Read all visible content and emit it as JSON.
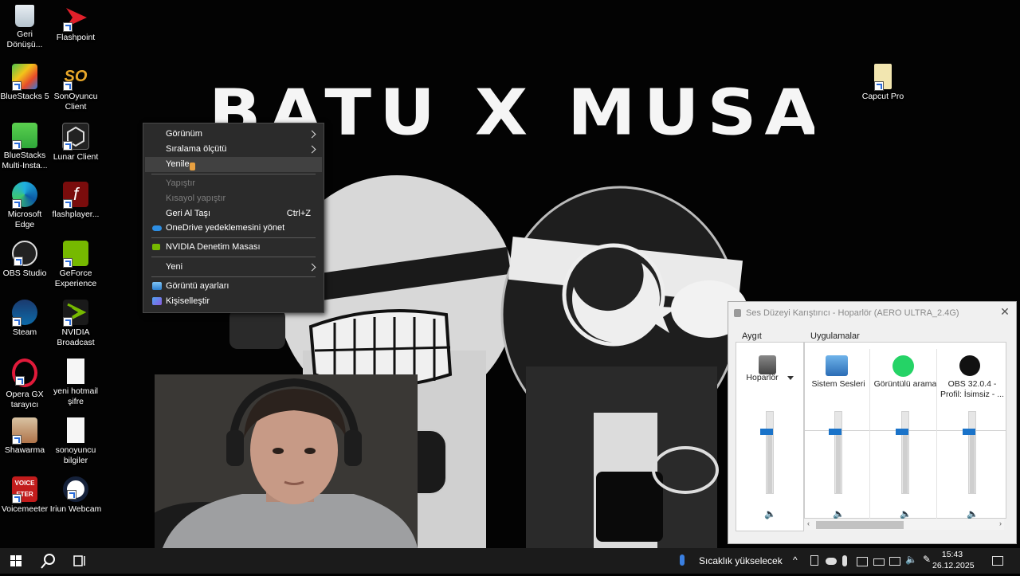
{
  "wallpaper": {
    "title": "BATU X MUSA"
  },
  "desktop_icons": [
    {
      "label": "Geri Dönüşü...",
      "icon": "recycle-bin-icon"
    },
    {
      "label": "Flashpoint",
      "icon": "flashpoint-icon"
    },
    {
      "label": "BlueStacks 5",
      "icon": "bluestacks-icon"
    },
    {
      "label": "SonOyuncu Client",
      "icon": "sonoyuncu-icon"
    },
    {
      "label": "BlueStacks Multi-Insta...",
      "icon": "bluestacks-multi-icon"
    },
    {
      "label": "Lunar Client",
      "icon": "lunar-client-icon"
    },
    {
      "label": "Microsoft Edge",
      "icon": "edge-icon"
    },
    {
      "label": "flashplayer...",
      "icon": "flashplayer-icon"
    },
    {
      "label": "OBS Studio",
      "icon": "obs-icon"
    },
    {
      "label": "GeForce Experience",
      "icon": "geforce-icon"
    },
    {
      "label": "Steam",
      "icon": "steam-icon"
    },
    {
      "label": "NVIDIA Broadcast",
      "icon": "nvidia-broadcast-icon"
    },
    {
      "label": "Opera GX tarayıcı",
      "icon": "opera-gx-icon"
    },
    {
      "label": "yeni hotmail şifre",
      "icon": "text-file-icon"
    },
    {
      "label": "Shawarma",
      "icon": "shawarma-icon"
    },
    {
      "label": "sonoyuncu bilgiler",
      "icon": "text-file-icon"
    },
    {
      "label": "Voicemeeter",
      "icon": "voicemeeter-icon"
    },
    {
      "label": "Iriun Webcam",
      "icon": "iriun-webcam-icon"
    },
    {
      "label": "Capcut Pro",
      "icon": "capcut-icon"
    }
  ],
  "context_menu": {
    "items": [
      {
        "label": "Görünüm",
        "submenu": true
      },
      {
        "label": "Sıralama ölçütü",
        "submenu": true
      },
      {
        "label": "Yenile",
        "hover": true
      },
      {
        "label": "Yapıştır",
        "disabled": true
      },
      {
        "label": "Kısayol yapıştır",
        "disabled": true
      },
      {
        "label": "Geri Al Taşı",
        "shortcut": "Ctrl+Z"
      },
      {
        "label": "OneDrive yedeklemesini yönet",
        "icon": "onedrive-icon"
      },
      {
        "label": "NVIDIA Denetim Masası",
        "icon": "nvidia-icon"
      },
      {
        "label": "Yeni",
        "submenu": true
      },
      {
        "label": "Görüntü ayarları",
        "icon": "display-icon"
      },
      {
        "label": "Kişiselleştir",
        "icon": "personalize-icon"
      }
    ]
  },
  "mixer": {
    "title": "Ses Düzeyi Karıştırıcı - Hoparlör (AERO ULTRA_2.4G)",
    "device_section": "Aygıt",
    "apps_section": "Uygulamalar",
    "channels": [
      {
        "name": "Hoparlör",
        "icon": "speaker-device-icon",
        "volume": 0.75,
        "dropdown": true
      },
      {
        "name": "Sistem Sesleri",
        "icon": "system-sounds-icon",
        "volume": 0.75
      },
      {
        "name": "Görüntülü arama",
        "icon": "whatsapp-icon",
        "volume": 0.75
      },
      {
        "name": "OBS 32.0.4 - Profil: İsimsiz - ...",
        "icon": "obs-icon",
        "volume": 0.75
      }
    ]
  },
  "taskbar": {
    "weather": "Sıcaklık yükselecek",
    "time": "15:43",
    "date": "26.12.2025"
  },
  "colors": {
    "accent": "#1a73c9",
    "menu_bg": "#2b2b2b",
    "taskbar_bg": "#1b1b1b"
  }
}
